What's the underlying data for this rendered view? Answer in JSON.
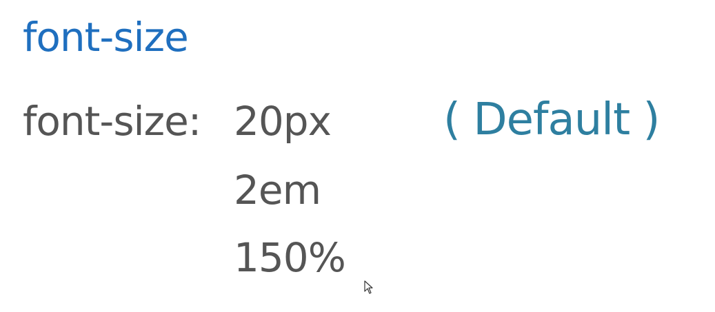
{
  "slide": {
    "title": "font-size",
    "property_label": "font-size:",
    "values": [
      "20px",
      "2em",
      "150%"
    ],
    "default_note": "( Default )"
  },
  "colors": {
    "title": "#1f6fbf",
    "text": "#555555",
    "note": "#2e7fa0",
    "background": "#ffffff"
  },
  "icons": {
    "cursor": "mouse-pointer-icon"
  }
}
